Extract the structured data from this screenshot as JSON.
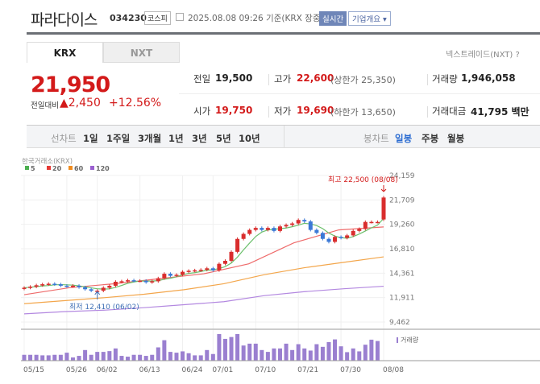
{
  "header": {
    "title": "파라다이스",
    "code": "034230",
    "market": "코스피",
    "timestamp": "2025.08.08 09:26 기준(KRX 장중)",
    "realtime": "실시간",
    "company_info": "기업개요 ▾"
  },
  "tabs": [
    {
      "label": "KRX",
      "active": true
    },
    {
      "label": "NXT",
      "active": false
    }
  ],
  "nxt_link": "넥스트레이드(NXT) ?",
  "quote": {
    "price": "21,950",
    "change_label": "전일대비",
    "change": "▲2,450",
    "change_pct": "+12.56%",
    "prev_label": "전일",
    "prev": "19,500",
    "high_label": "고가",
    "high": "22,600",
    "upper_limit": "(상한가 25,350)",
    "volume_label": "거래량",
    "volume": "1,946,058",
    "open_label": "시가",
    "open": "19,750",
    "low_label": "저가",
    "low": "19,690",
    "lower_limit": "(하한가 13,650)",
    "amount_label": "거래대금",
    "amount": "41,795 백만"
  },
  "periods": {
    "line_label": "선차트",
    "line": [
      "1일",
      "1주일",
      "3개월",
      "1년",
      "3년",
      "5년",
      "10년"
    ],
    "candle_label": "봉차트",
    "candle": [
      "일봉",
      "주봉",
      "월봉"
    ],
    "active": "일봉"
  },
  "chart_data": {
    "type": "candlestick",
    "title": "한국거래소(KRX)",
    "legend": [
      {
        "name": "5",
        "color": "#4caf50"
      },
      {
        "name": "20",
        "color": "#e53935"
      },
      {
        "name": "60",
        "color": "#f08c1e"
      },
      {
        "name": "120",
        "color": "#9a5fd0"
      }
    ],
    "y_ticks": [
      "24,159",
      "21,709",
      "19,260",
      "16,810",
      "14,361",
      "11,911",
      "9,462"
    ],
    "ylim": [
      9462,
      24159
    ],
    "x_labels": [
      {
        "label": "05/15",
        "i": 0
      },
      {
        "label": "05/26",
        "i": 7
      },
      {
        "label": "06/02",
        "i": 12
      },
      {
        "label": "06/13",
        "i": 19
      },
      {
        "label": "06/24",
        "i": 26
      },
      {
        "label": "07/01",
        "i": 31
      },
      {
        "label": "07/10",
        "i": 38
      },
      {
        "label": "07/21",
        "i": 45
      },
      {
        "label": "07/30",
        "i": 52
      },
      {
        "label": "08/08",
        "i": 59
      }
    ],
    "close": [
      12900,
      13000,
      13150,
      13250,
      13300,
      13250,
      13100,
      13050,
      13100,
      12950,
      12750,
      12600,
      12600,
      12900,
      13100,
      13500,
      13550,
      13650,
      13600,
      13600,
      13450,
      13550,
      13850,
      14300,
      14100,
      14200,
      14500,
      14600,
      14650,
      14700,
      14850,
      14650,
      15300,
      15600,
      16500,
      17800,
      18300,
      18700,
      18900,
      18700,
      18900,
      18600,
      19050,
      19200,
      19350,
      19700,
      19550,
      18700,
      18400,
      17800,
      17500,
      18000,
      17900,
      18150,
      18600,
      18800,
      19500,
      19500,
      19500,
      21950
    ],
    "ma20": [
      12200,
      12900,
      13300,
      13800,
      14300,
      15300,
      17400,
      18700,
      19000
    ],
    "ma60": [
      11300,
      11600,
      11900,
      12250,
      12700,
      13300,
      14200,
      14900,
      15450,
      16000
    ],
    "ma120": [
      10280,
      10500,
      10650,
      10900,
      11200,
      11500,
      12100,
      12500,
      12800,
      13050
    ],
    "volume_rel": [
      22,
      22,
      22,
      20,
      20,
      22,
      22,
      30,
      12,
      18,
      40,
      22,
      33,
      33,
      36,
      46,
      18,
      15,
      22,
      22,
      18,
      22,
      50,
      77,
      33,
      30,
      35,
      28,
      20,
      20,
      40,
      25,
      100,
      82,
      89,
      100,
      57,
      64,
      64,
      40,
      33,
      46,
      46,
      64,
      40,
      62,
      46,
      38,
      62,
      52,
      70,
      80,
      54,
      32,
      46,
      35,
      60,
      79,
      74,
      0
    ],
    "annotations": {
      "high": "최고 22,500 (08/08)",
      "low": "최저 12,410 (06/02)"
    },
    "volume_label": "거래량"
  }
}
